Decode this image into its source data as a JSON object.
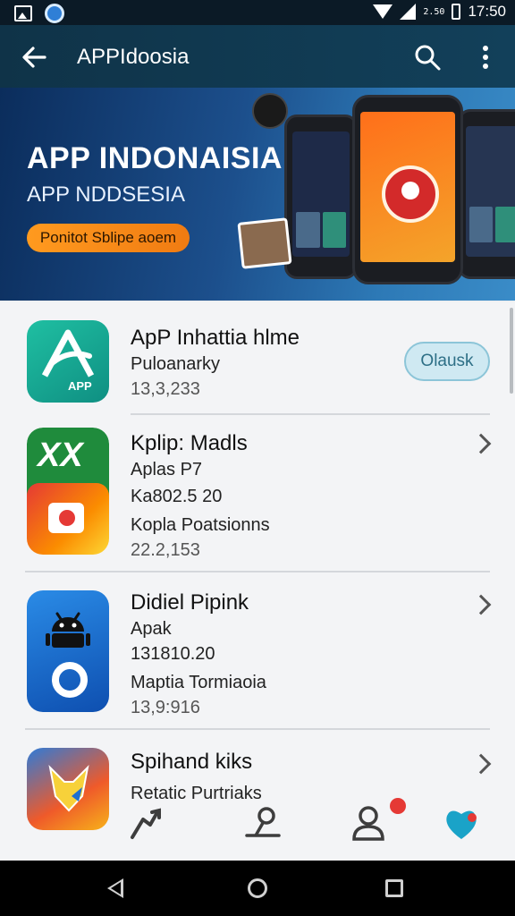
{
  "status_bar": {
    "time": "17:50",
    "data_speed": "2.50",
    "icons": [
      "gallery-icon",
      "app-circle-icon",
      "wifi-icon",
      "signal-icon",
      "battery-icon"
    ]
  },
  "app_bar": {
    "title": "APPIdoosia",
    "icons": [
      "back-arrow-icon",
      "search-icon",
      "more-vert-icon"
    ]
  },
  "banner": {
    "title": "APP INDONAISIA",
    "subtitle": "APP NDDSESIA",
    "button_label": "Ponitot Sblipe aoem"
  },
  "apps": [
    {
      "name": "ApP Inhattia hlme",
      "line1": "Puloanarky",
      "line2": "13,3,233",
      "action": "Olausk",
      "icon_text": "APP"
    },
    {
      "name": "Kplip: Madls",
      "line1": "Aplas P7",
      "line2": "Ka802.5 20",
      "line3": "Kopla Poatsionns",
      "line4": "22.2,153",
      "icon_text": "XX"
    },
    {
      "name": "Didiel Pipink",
      "line1": "Apak",
      "line2": "131810.20",
      "line3": "Maptia Tormiaoia",
      "line4": "13,9:916"
    },
    {
      "name": "Spihand kiks",
      "line1": "Retatic Purtriaks"
    }
  ],
  "bottom_tabs": [
    "home-tab-icon",
    "activity-tab-icon",
    "profile-tab-icon",
    "favorites-tab-icon"
  ],
  "nav_bar": [
    "nav-back-icon",
    "nav-home-icon",
    "nav-recent-icon"
  ],
  "colors": {
    "app_bar": "#0f3348",
    "banner_button": "#f58a18",
    "open_button": "#cfe9f2",
    "accent_teal": "#1fbfa2"
  }
}
